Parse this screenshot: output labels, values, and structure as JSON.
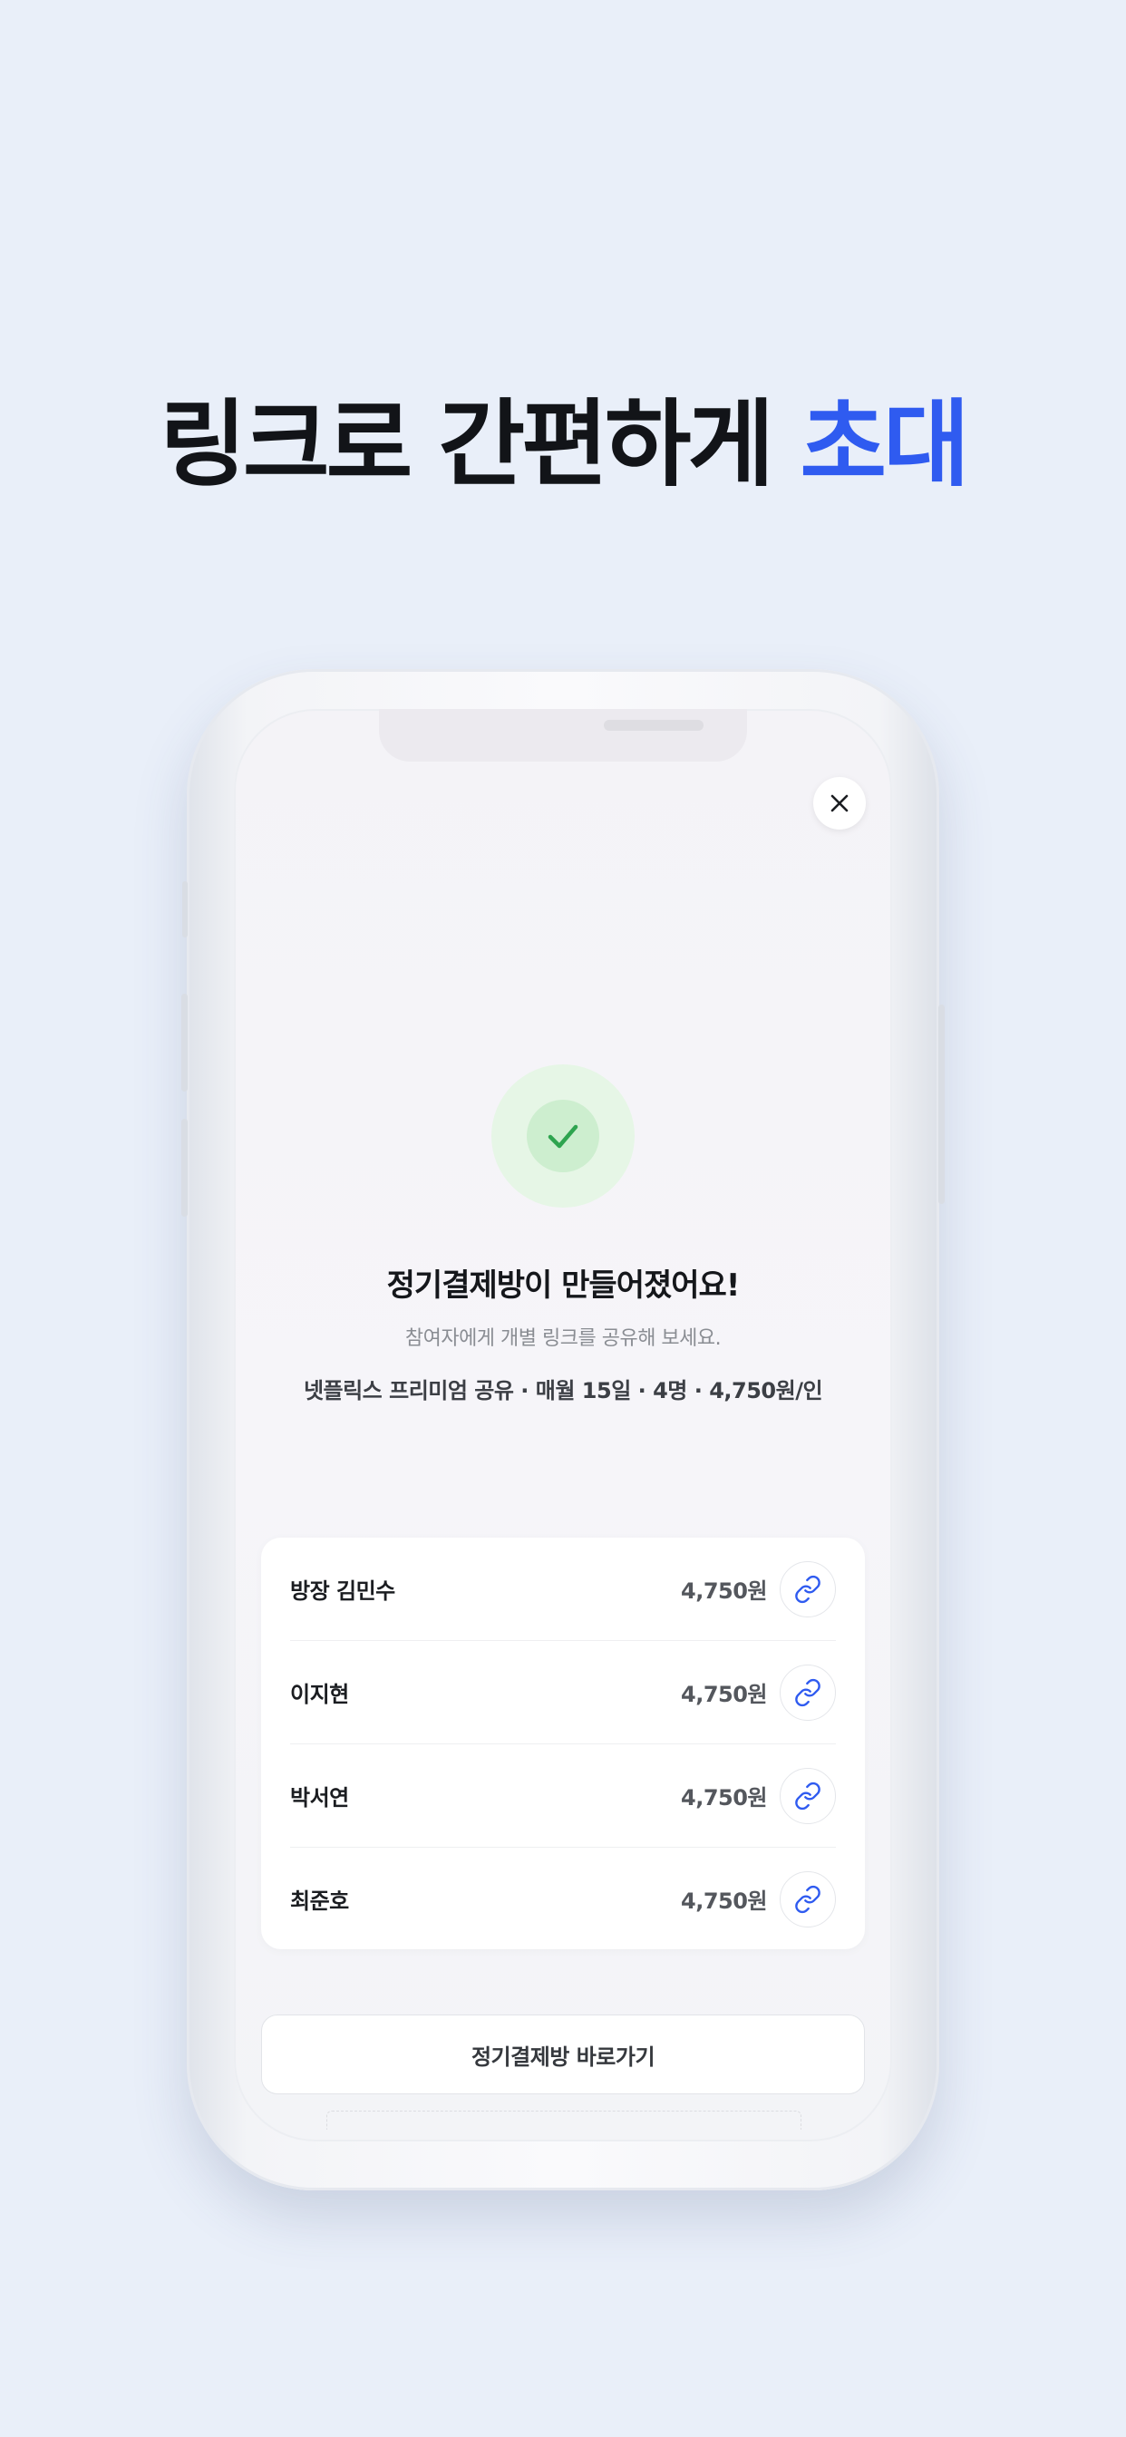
{
  "headline": {
    "text": "링크로 간편하게",
    "accent": "초대",
    "accent_color": "#2f5bf0"
  },
  "screen": {
    "close_icon": "close-icon",
    "success_icon": "check-icon",
    "title": "정기결제방이 만들어졌어요!",
    "subtitle": "참여자에게 개별 링크를 공유해 보세요.",
    "summary": "넷플릭스 프리미엄 공유 · 매월 15일 · 4명 · 4,750원/인",
    "members": [
      {
        "name": "방장 김민수",
        "amount": "4,750원",
        "icon": "link-icon"
      },
      {
        "name": "이지현",
        "amount": "4,750원",
        "icon": "link-icon"
      },
      {
        "name": "박서연",
        "amount": "4,750원",
        "icon": "link-icon"
      },
      {
        "name": "최준호",
        "amount": "4,750원",
        "icon": "link-icon"
      }
    ],
    "go_button": "정기결제방 바로가기",
    "link_icon_color": "#2f5bf0",
    "success_color": "#2ea44f"
  }
}
